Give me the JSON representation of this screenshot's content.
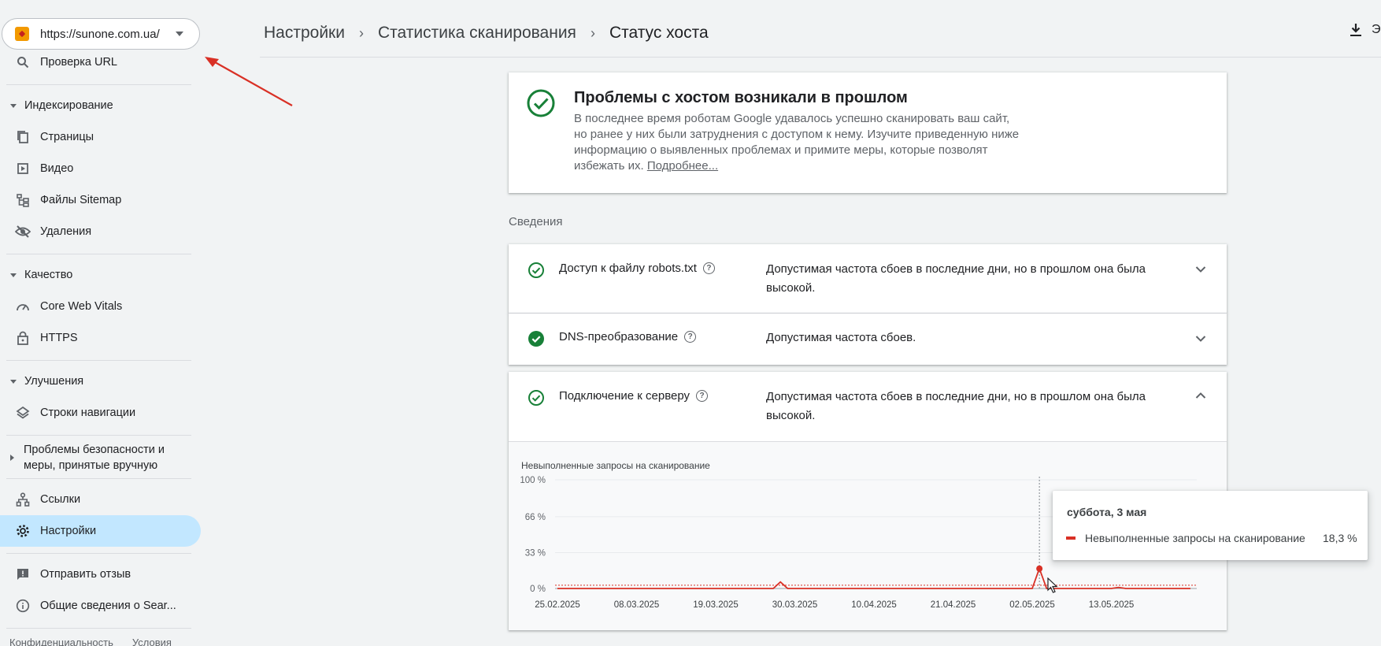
{
  "property": {
    "url": "https://sunone.com.ua/"
  },
  "sidebar": {
    "url_inspection": "Проверка URL",
    "indexing": {
      "title": "Индексирование",
      "items": [
        "Страницы",
        "Видео",
        "Файлы Sitemap",
        "Удаления"
      ]
    },
    "quality": {
      "title": "Качество",
      "items": [
        "Core Web Vitals",
        "HTTPS"
      ]
    },
    "enhancements": {
      "title": "Улучшения",
      "items": [
        "Строки навигации"
      ]
    },
    "security": {
      "title_line1": "Проблемы безопасности и",
      "title_line2": "меры, принятые вручную"
    },
    "links": "Ссылки",
    "settings": "Настройки",
    "feedback": "Отправить отзыв",
    "about": "Общие сведения о Sear...",
    "footer": [
      "Конфиденциальность",
      "Условия"
    ]
  },
  "breadcrumb": [
    "Настройки",
    "Статистика сканирования",
    "Статус хоста"
  ],
  "export_label": "Э",
  "status": {
    "title": "Проблемы с хостом возникали в прошлом",
    "description_lines": [
      "В последнее время роботам Google удавалось успешно сканировать ваш сайт,",
      "но ранее у них были затруднения с доступом к нему. Изучите приведенную ниже",
      "информацию о выявленных проблемах и примите меры, которые позволят"
    ],
    "description_last": "избежать их. ",
    "learn_more": "Подробнее..."
  },
  "details_label": "Сведения",
  "checks": [
    {
      "name": "Доступ к файлу robots.txt",
      "value_line1": "Допустимая частота сбоев в последние дни, но в прошлом она была",
      "value_line2": "высокой."
    },
    {
      "name": "DNS-преобразование",
      "value_line1": "Допустимая частота сбоев.",
      "value_line2": ""
    },
    {
      "name": "Подключение к серверу",
      "value_line1": "Допустимая частота сбоев в последние дни, но в прошлом она была",
      "value_line2": "высокой."
    }
  ],
  "chart_data": {
    "type": "line",
    "title": "Невыполненные запросы на сканирование",
    "ytick_labels": [
      "100 %",
      "66 %",
      "33 %",
      "0 %"
    ],
    "yticks": [
      100,
      66,
      33,
      0
    ],
    "ylim": [
      0,
      100
    ],
    "xtick_labels": [
      "25.02.2025",
      "08.03.2025",
      "19.03.2025",
      "30.03.2025",
      "10.04.2025",
      "21.04.2025",
      "02.05.2025",
      "13.05.2025"
    ],
    "series": [
      {
        "name": "Невыполненные запросы на сканирование",
        "color": "#d93025",
        "x": [
          "2025-02-25",
          "2025-03-01",
          "2025-03-08",
          "2025-03-15",
          "2025-03-19",
          "2025-03-25",
          "2025-03-27",
          "2025-03-28",
          "2025-03-29",
          "2025-03-30",
          "2025-04-05",
          "2025-04-10",
          "2025-04-15",
          "2025-04-21",
          "2025-04-27",
          "2025-05-01",
          "2025-05-02",
          "2025-05-03",
          "2025-05-04",
          "2025-05-05",
          "2025-05-10",
          "2025-05-13",
          "2025-05-14",
          "2025-05-15",
          "2025-05-20",
          "2025-05-24"
        ],
        "y": [
          0,
          0,
          0,
          0,
          0,
          0,
          0,
          6,
          0,
          0,
          0,
          0,
          0,
          0,
          0,
          0,
          0,
          18.3,
          0,
          0,
          0,
          0,
          1,
          0,
          0,
          0
        ]
      }
    ],
    "threshold": 3,
    "tooltip": {
      "date": "суббота, 3 мая",
      "value": "18,3 %"
    }
  }
}
